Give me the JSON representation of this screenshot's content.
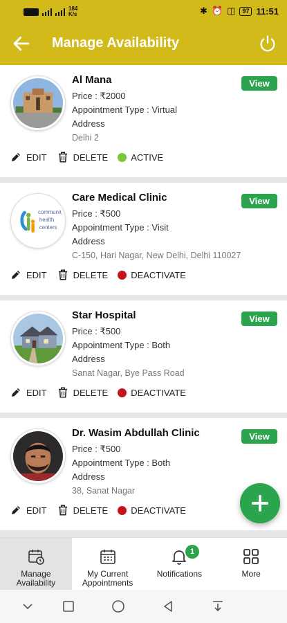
{
  "status_bar": {
    "speed": "184 K/s",
    "battery": "97",
    "time": "11:51"
  },
  "header": {
    "title": "Manage Availability"
  },
  "labels": {
    "edit": "EDIT",
    "delete": "DELETE",
    "view": "View"
  },
  "cards": [
    {
      "name": "Al Mana",
      "price": "Price :  ₹2000",
      "appointment_type": "Appointment Type :  Virtual",
      "address_label": "Address",
      "address": "Delhi 2",
      "status": "ACTIVE",
      "status_color": "#7cc63a"
    },
    {
      "name": "Care Medical Clinic",
      "price": "Price :  ₹500",
      "appointment_type": "Appointment Type :  Visit",
      "address_label": "Address",
      "address": "C-150, Hari Nagar, New Delhi, Delhi 110027",
      "status": "DEACTIVATE",
      "status_color": "#c4141b"
    },
    {
      "name": "Star Hospital",
      "price": "Price :  ₹500",
      "appointment_type": "Appointment Type :  Both",
      "address_label": "Address",
      "address": "Sanat Nagar, Bye Pass Road",
      "status": "DEACTIVATE",
      "status_color": "#c4141b"
    },
    {
      "name": "Dr. Wasim Abdullah Clinic",
      "price": "Price :  ₹500",
      "appointment_type": "Appointment Type :  Both",
      "address_label": "Address",
      "address": "38, Sanat Nagar",
      "status": "DEACTIVATE",
      "status_color": "#c4141b"
    }
  ],
  "logo_text": "community health centers",
  "bottom_nav": [
    {
      "label": "Manage Availability",
      "icon": "calendar-clock-icon"
    },
    {
      "label": "My Current Appointments",
      "icon": "calendar-grid-icon"
    },
    {
      "label": "Notifications",
      "icon": "bell-icon",
      "badge": "1"
    },
    {
      "label": "More",
      "icon": "grid-icon"
    }
  ],
  "colors": {
    "brand": "#d3ba1b",
    "accent": "#2aa54e",
    "active": "#7cc63a",
    "inactive": "#c4141b"
  }
}
